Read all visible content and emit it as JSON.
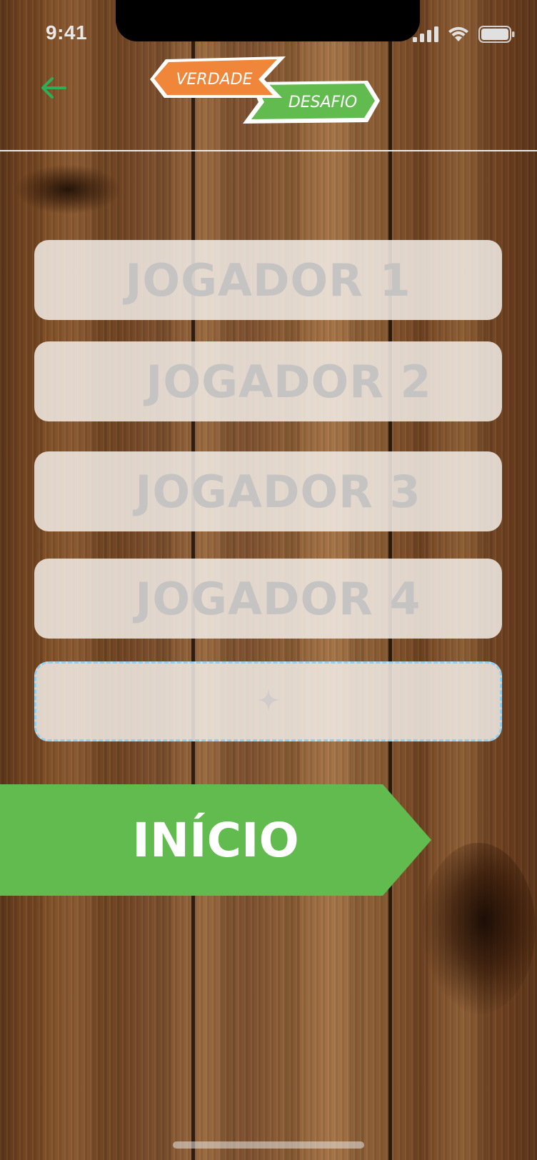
{
  "status_bar": {
    "time": "9:41"
  },
  "header": {
    "back_icon": "arrow-left-icon",
    "logo": {
      "word_truth": "VERDADE",
      "word_dare": "DESAFIO",
      "truth_color": "#f0863a",
      "dare_color": "#62bb4e"
    }
  },
  "players": [
    {
      "placeholder": "JOGADOR 1"
    },
    {
      "placeholder": "JOGADOR 2"
    },
    {
      "placeholder": "JOGADOR 3"
    },
    {
      "placeholder": "JOGADOR 4"
    }
  ],
  "add_player": {
    "icon": "sparkle-plus-icon"
  },
  "start_button": {
    "label": "INÍCIO",
    "color": "#62bb4e"
  },
  "colors": {
    "back_arrow": "#2fae57",
    "add_border": "#8fd0f2"
  }
}
